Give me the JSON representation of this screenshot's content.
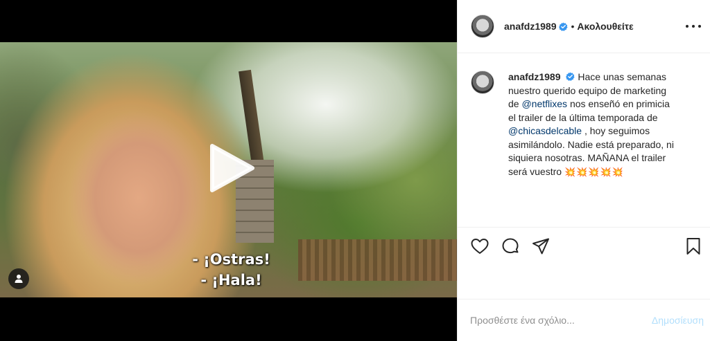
{
  "post": {
    "author": "anafdz1989",
    "follow_status": "Ακολουθείτε",
    "dot": "•",
    "verified": true
  },
  "video": {
    "subtitle_line1": "- ¡Ostras!",
    "subtitle_line2": "- ¡Hala!"
  },
  "caption": {
    "username": "anafdz1989",
    "text_part1": "Hace unas semanas nuestro querido equipo de marketing de",
    "mention1": "@netflixes",
    "text_part2": "nos enseñó en primicia el trailer de la última temporada de",
    "mention2": "@chicasdelcable",
    "text_part3": ", hoy seguimos asimilándolo. Nadie está preparado, ni siquiera nosotras. MAÑANA el trailer será vuestro",
    "emojis": "💥💥💥💥💥"
  },
  "comment": {
    "placeholder": "Προσθέστε ένα σχόλιο...",
    "post_label": "Δημοσίευση"
  },
  "colors": {
    "verified_blue": "#3897f0",
    "mention_blue": "#00376b",
    "post_disabled": "#b2dffc"
  },
  "icons": [
    "play-icon",
    "person-tag-icon",
    "verified-badge-icon",
    "more-options-icon",
    "heart-icon",
    "comment-icon",
    "share-icon",
    "bookmark-icon"
  ]
}
